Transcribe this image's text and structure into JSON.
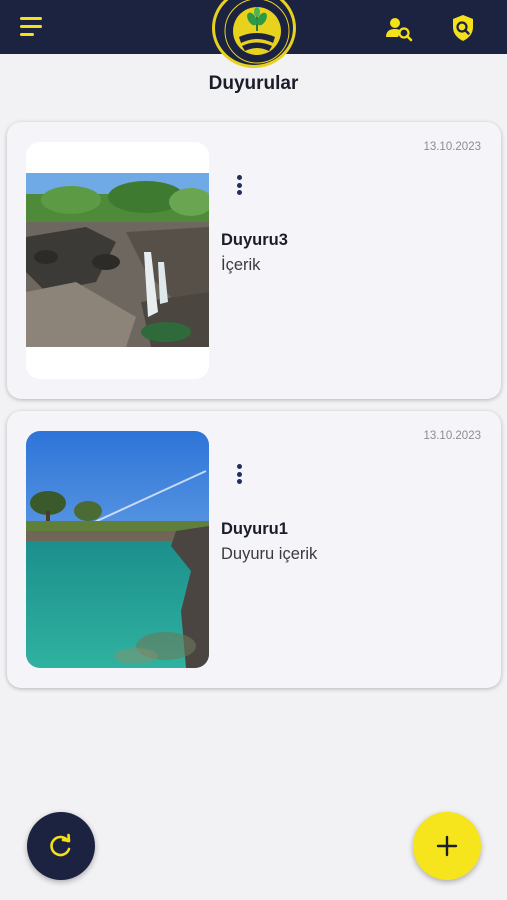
{
  "header": {
    "menu_icon": "hamburger-menu-icon",
    "logo_icon": "association-logo-emblem",
    "user_search_icon": "user-search-icon",
    "shield_search_icon": "shield-search-icon",
    "accent_color": "#f5e11a",
    "bar_color": "#1b2341"
  },
  "page": {
    "title": "Duyurular"
  },
  "announcements": [
    {
      "date": "13.10.2023",
      "title": "Duyuru3",
      "body": "İçerik",
      "image": "waterfall-photo"
    },
    {
      "date": "13.10.2023",
      "title": "Duyuru1",
      "body": "Duyuru içerik",
      "image": "turquoise-lake-photo"
    }
  ],
  "actions": {
    "refresh_icon": "refresh-icon",
    "add_icon": "plus-icon"
  }
}
